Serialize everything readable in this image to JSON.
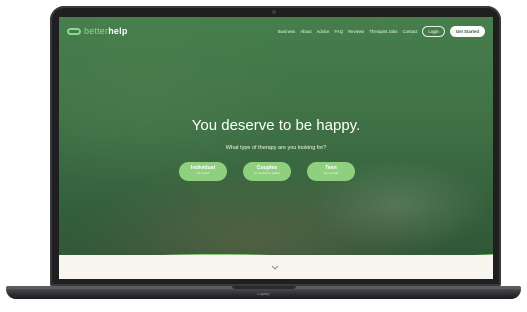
{
  "device": {
    "label": "Laptop"
  },
  "nav": {
    "logo_light": "better",
    "logo_bold": "help",
    "links": [
      "Business",
      "About",
      "Advice",
      "FAQ",
      "Reviews",
      "Therapist Jobs",
      "Contact"
    ],
    "login": "Login",
    "get_started": "Get Started"
  },
  "hero": {
    "title": "You deserve to be happy.",
    "subtitle": "What type of therapy are you looking for?",
    "options": [
      {
        "title": "Individual",
        "desc": "For myself"
      },
      {
        "title": "Couples",
        "desc": "For me and my partner"
      },
      {
        "title": "Teen",
        "desc": "For my child"
      }
    ]
  },
  "colors": {
    "brand_green": "#8fd07f",
    "hero_green": "#4a7f50",
    "accent_light_green": "#8fd88a"
  },
  "icons": {
    "scroll": "chevron-down-icon",
    "logo": "betterhelp-logo-icon"
  }
}
